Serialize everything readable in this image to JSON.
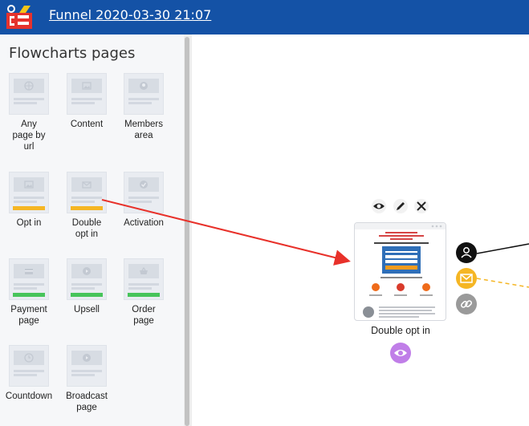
{
  "header": {
    "title": "Funnel 2020-03-30 21:07"
  },
  "sidebar": {
    "title": "Flowcharts pages",
    "items": [
      {
        "label_lines": [
          "Any",
          "page by",
          "url"
        ],
        "accent": "none",
        "icon": "globe-icon"
      },
      {
        "label_lines": [
          "Content"
        ],
        "accent": "none",
        "icon": "image-icon"
      },
      {
        "label_lines": [
          "Members",
          "area"
        ],
        "accent": "none",
        "icon": "user-icon"
      },
      {
        "label_lines": [
          "Opt in"
        ],
        "accent": "#f5b624",
        "icon": "image-icon"
      },
      {
        "label_lines": [
          "Double",
          "opt in"
        ],
        "accent": "#f5b624",
        "icon": "envelope-icon"
      },
      {
        "label_lines": [
          "Activation"
        ],
        "accent": "none",
        "icon": "check-icon"
      },
      {
        "label_lines": [
          "Payment",
          "page"
        ],
        "accent": "#47c45a",
        "icon": "card-icon"
      },
      {
        "label_lines": [
          "Upsell"
        ],
        "accent": "#47c45a",
        "icon": "play-icon"
      },
      {
        "label_lines": [
          "Order",
          "page"
        ],
        "accent": "#47c45a",
        "icon": "basket-icon"
      },
      {
        "label_lines": [
          "Countdown"
        ],
        "accent": "none",
        "icon": "clock-icon"
      },
      {
        "label_lines": [
          "Broadcast",
          "page"
        ],
        "accent": "none",
        "icon": "play-icon"
      }
    ]
  },
  "canvas": {
    "node": {
      "label": "Double opt in",
      "tools": [
        "eye-icon",
        "pencil-icon",
        "close-icon"
      ]
    },
    "connectors": [
      "user-icon",
      "envelope-icon",
      "link-icon"
    ],
    "colors": {
      "arrow": "#e8312a",
      "connector_user": "#111111",
      "connector_mail": "#f5b624",
      "connector_link": "#9a9a9a",
      "preview": "#c07ee8"
    }
  }
}
